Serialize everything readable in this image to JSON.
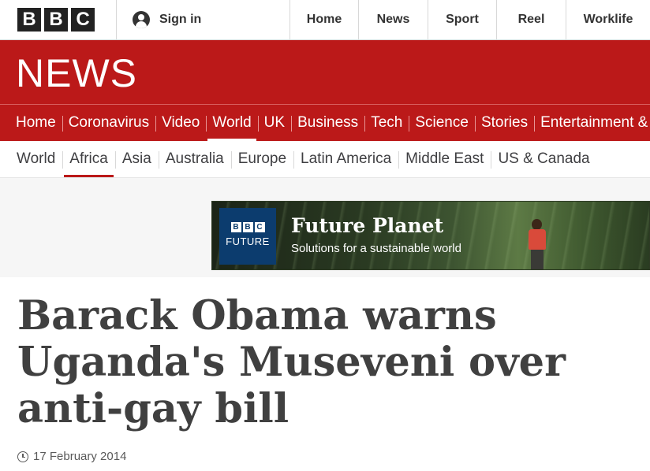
{
  "brand": {
    "logo_letters": [
      "B",
      "B",
      "C"
    ]
  },
  "account": {
    "signin_label": "Sign in"
  },
  "top_nav": [
    "Home",
    "News",
    "Sport",
    "Reel",
    "Worklife"
  ],
  "section": {
    "wordmark": "NEWS"
  },
  "primary_nav": {
    "items": [
      "Home",
      "Coronavirus",
      "Video",
      "World",
      "UK",
      "Business",
      "Tech",
      "Science",
      "Stories",
      "Entertainment & Arts"
    ],
    "active": "World"
  },
  "secondary_nav": {
    "items": [
      "World",
      "Africa",
      "Asia",
      "Australia",
      "Europe",
      "Latin America",
      "Middle East",
      "US & Canada"
    ],
    "active": "Africa"
  },
  "promo": {
    "logo_bbc": [
      "B",
      "B",
      "C"
    ],
    "logo_future": "FUTURE",
    "title": "Future Planet",
    "subtitle": "Solutions for a sustainable world"
  },
  "article": {
    "headline": "Barack Obama warns Uganda's Museveni over anti-gay bill",
    "date": "17 February 2014"
  },
  "colors": {
    "brand_red": "#bb1919",
    "headline_gray": "#404040"
  }
}
